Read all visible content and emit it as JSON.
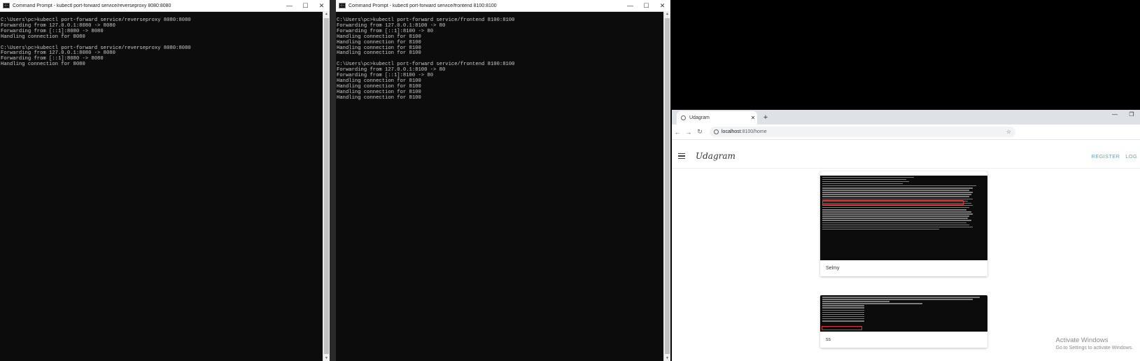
{
  "left_console": {
    "title": "Command Prompt - kubectl  port-forward service/reverseproxy 8080:8080",
    "lines": "C:\\Users\\pc>kubectl port-forward service/reverseproxy 8080:8080\nForwarding from 127.0.0.1:8080 -> 8080\nForwarding from [::1]:8080 -> 8080\nHandling connection for 8080\n\nC:\\Users\\pc>kubectl port-forward service/reverseproxy 8080:8080\nForwarding from 127.0.0.1:8080 -> 8080\nForwarding from [::1]:8080 -> 8080\nHandling connection for 8080"
  },
  "right_console": {
    "title": "Command Prompt - kubectl  port-forward service/frontend 8100:8100",
    "lines": "C:\\Users\\pc>kubectl port-forward service/frontend 8100:8100\nForwarding from 127.0.0.1:8100 -> 80\nForwarding from [::1]:8100 -> 80\nHandling connection for 8100\nHandling connection for 8100\nHandling connection for 8100\nHandling connection for 8100\n\nC:\\Users\\pc>kubectl port-forward service/frontend 8100:8100\nForwarding from 127.0.0.1:8100 -> 80\nForwarding from [::1]:8100 -> 80\nHandling connection for 8100\nHandling connection for 8100\nHandling connection for 8100\nHandling connection for 8100"
  },
  "window_controls": {
    "minimize": "—",
    "maximize": "☐",
    "close": "✕"
  },
  "browser": {
    "tab_title": "Udagram",
    "new_tab": "+",
    "url_host": "localhost",
    "url_path": ":8100/home",
    "controls": {
      "minimize": "—",
      "restore": "❐"
    }
  },
  "app": {
    "brand": "Udagram",
    "register": "REGISTER",
    "login": "LOG"
  },
  "feed": [
    {
      "caption": "Selmy"
    },
    {
      "caption": "ss"
    }
  ],
  "watermark": {
    "line1": "Activate Windows",
    "line2": "Go to Settings to activate Windows."
  },
  "colors": {
    "console_bg": "#0c0c0c",
    "console_text": "#cccccc",
    "accent": "#3cb0e0"
  }
}
